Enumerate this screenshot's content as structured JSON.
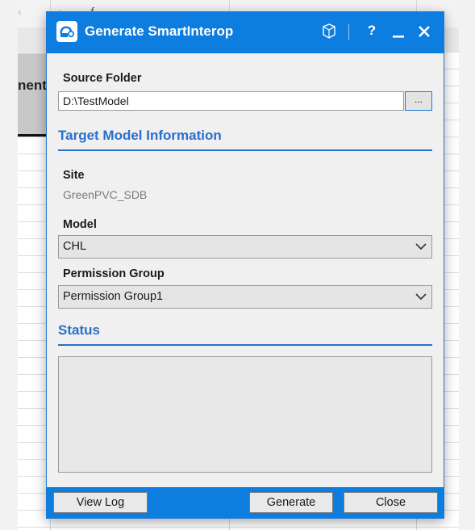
{
  "background": {
    "cell_text": "nent"
  },
  "dialog": {
    "title": "Generate SmartInterop",
    "help_glyph": "?",
    "source_folder": {
      "label": "Source Folder",
      "value": "D:\\TestModel",
      "browse_label": "..."
    },
    "target_section": {
      "heading": "Target Model Information",
      "site_label": "Site",
      "site_value": "GreenPVC_SDB",
      "model_label": "Model",
      "model_value": "CHL",
      "permission_label": "Permission Group",
      "permission_value": "Permission Group1"
    },
    "status_section": {
      "heading": "Status"
    },
    "footer": {
      "view_log_label": "View Log",
      "generate_label": "Generate",
      "close_label": "Close"
    }
  },
  "colors": {
    "accent": "#0d7de0",
    "section_heading": "#2a6fcc"
  },
  "icons": [
    "app-logo-icon",
    "connector-icon",
    "help-icon",
    "minimize-icon",
    "close-icon",
    "chevron-down-icon"
  ]
}
